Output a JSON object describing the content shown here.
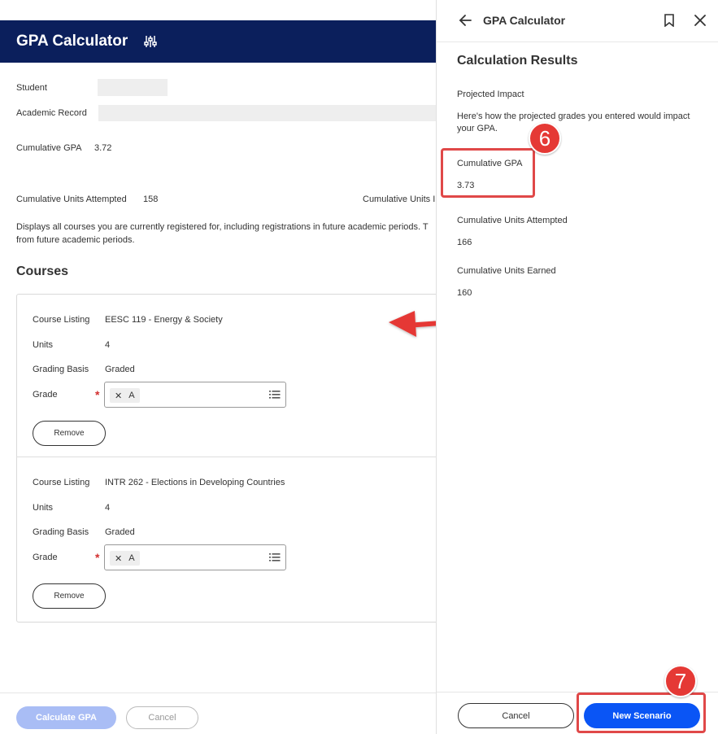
{
  "main": {
    "title": "GPA Calculator",
    "student_label": "Student",
    "academic_record_label": "Academic Record",
    "cumulative_gpa_label": "Cumulative GPA",
    "cumulative_gpa_value": "3.72",
    "units_attempted_label": "Cumulative Units Attempted",
    "units_attempted_value": "158",
    "units_earned_label_partial": "Cumulative Units I",
    "description": "Displays all courses you are currently registered for, including registrations in future academic periods. T from future academic periods.",
    "courses_title": "Courses",
    "courses": [
      {
        "listing_label": "Course Listing",
        "listing_value": "EESC 119 - Energy & Society",
        "units_label": "Units",
        "units_value": "4",
        "grading_label": "Grading Basis",
        "grading_value": "Graded",
        "grade_label": "Grade",
        "grade_value": "A",
        "remove_label": "Remove"
      },
      {
        "listing_label": "Course Listing",
        "listing_value": "INTR 262 - Elections in Developing Countries",
        "units_label": "Units",
        "units_value": "4",
        "grading_label": "Grading Basis",
        "grading_value": "Graded",
        "grade_label": "Grade",
        "grade_value": "A",
        "remove_label": "Remove"
      }
    ],
    "calculate_button": "Calculate GPA",
    "cancel_button": "Cancel"
  },
  "panel": {
    "title": "GPA Calculator",
    "results_heading": "Calculation Results",
    "projected_impact_label": "Projected Impact",
    "projected_impact_text_1": "Here's how the projected grades you entered would impact",
    "projected_impact_text_2": "your GPA.",
    "cumulative_gpa_label": "Cumulative GPA",
    "cumulative_gpa_value": "3.73",
    "units_attempted_label": "Cumulative Units Attempted",
    "units_attempted_value": "166",
    "units_earned_label": "Cumulative Units Earned",
    "units_earned_value": "160",
    "cancel_button": "Cancel",
    "new_scenario_button": "New Scenario"
  },
  "annotations": {
    "badge_6": "6",
    "badge_7": "7",
    "highlight_color": "#e04848"
  },
  "colors": {
    "header_bg": "#0b1f5c",
    "primary_blue": "#0a55f5",
    "disabled_blue": "#a9bdf5",
    "required_red": "#d32f2f"
  }
}
